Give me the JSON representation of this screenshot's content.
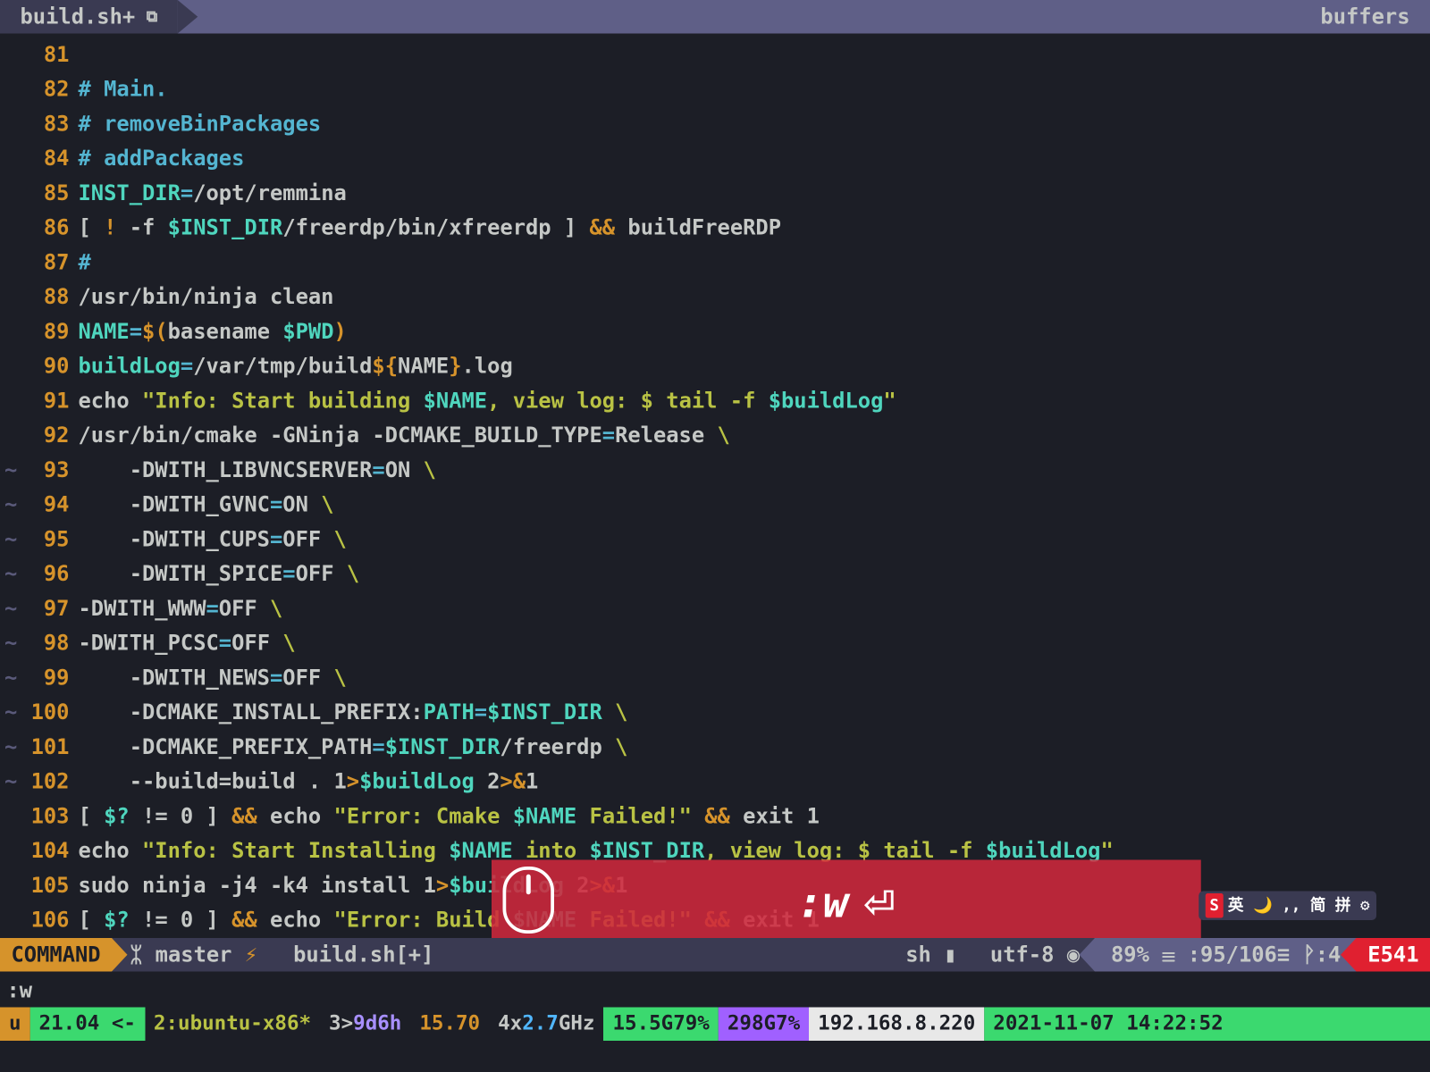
{
  "tab": {
    "name": "build.sh+",
    "right": "buffers"
  },
  "code": [
    {
      "n": 81,
      "tilde": false,
      "tokens": []
    },
    {
      "n": 82,
      "tilde": false,
      "tokens": [
        [
          "c-comment",
          "# Main."
        ]
      ]
    },
    {
      "n": 83,
      "tilde": false,
      "tokens": [
        [
          "c-comment",
          "# removeBinPackages"
        ]
      ]
    },
    {
      "n": 84,
      "tilde": false,
      "tokens": [
        [
          "c-comment",
          "# addPackages"
        ]
      ]
    },
    {
      "n": 85,
      "tilde": false,
      "tokens": [
        [
          "c-var",
          "INST_DIR"
        ],
        [
          "c-eq",
          "="
        ],
        [
          "c-plain",
          "/opt/remmina"
        ]
      ]
    },
    {
      "n": 86,
      "tilde": false,
      "tokens": [
        [
          "c-plain",
          "[ "
        ],
        [
          "c-yellow",
          "!"
        ],
        [
          "c-plain",
          " -f "
        ],
        [
          "c-var",
          "$INST_DIR"
        ],
        [
          "c-plain",
          "/freerdp/bin/xfreerdp ] "
        ],
        [
          "c-yellow",
          "&&"
        ],
        [
          "c-plain",
          " buildFreeRDP"
        ]
      ]
    },
    {
      "n": 87,
      "tilde": false,
      "tokens": [
        [
          "c-comment",
          "#"
        ]
      ]
    },
    {
      "n": 88,
      "tilde": false,
      "tokens": [
        [
          "c-plain",
          "/usr/bin/ninja clean"
        ]
      ]
    },
    {
      "n": 89,
      "tilde": false,
      "tokens": [
        [
          "c-var",
          "NAME"
        ],
        [
          "c-eq",
          "="
        ],
        [
          "c-yellow",
          "$("
        ],
        [
          "c-plain",
          "basename "
        ],
        [
          "c-var",
          "$PWD"
        ],
        [
          "c-yellow",
          ")"
        ]
      ]
    },
    {
      "n": 90,
      "tilde": false,
      "tokens": [
        [
          "c-var",
          "buildLog"
        ],
        [
          "c-eq",
          "="
        ],
        [
          "c-plain",
          "/var/tmp/build"
        ],
        [
          "c-yellow",
          "${"
        ],
        [
          "c-plain",
          "NAME"
        ],
        [
          "c-yellow",
          "}"
        ],
        [
          "c-plain",
          ".log"
        ]
      ]
    },
    {
      "n": 91,
      "tilde": false,
      "tokens": [
        [
          "c-plain",
          "echo "
        ],
        [
          "c-str",
          "\"Info: Start building "
        ],
        [
          "c-strvar",
          "$NAME"
        ],
        [
          "c-str",
          ", view log: $ tail -f "
        ],
        [
          "c-strvar",
          "$buildLog"
        ],
        [
          "c-str",
          "\""
        ]
      ]
    },
    {
      "n": 92,
      "tilde": false,
      "tokens": [
        [
          "c-plain",
          "/usr/bin/cmake -GNinja -DCMAKE_BUILD_TYPE"
        ],
        [
          "c-eq",
          "="
        ],
        [
          "c-plain",
          "Release "
        ],
        [
          "c-escape",
          "\\"
        ]
      ]
    },
    {
      "n": 93,
      "tilde": true,
      "tokens": [
        [
          "c-plain",
          "    -DWITH_LIBVNCSERVER"
        ],
        [
          "c-eq",
          "="
        ],
        [
          "c-plain",
          "ON "
        ],
        [
          "c-escape",
          "\\"
        ]
      ]
    },
    {
      "n": 94,
      "tilde": true,
      "tokens": [
        [
          "c-plain",
          "    -DWITH_GVNC"
        ],
        [
          "c-eq",
          "="
        ],
        [
          "c-plain",
          "ON "
        ],
        [
          "c-escape",
          "\\"
        ]
      ]
    },
    {
      "n": 95,
      "tilde": true,
      "tokens": [
        [
          "c-plain",
          "    -DWITH_CUPS"
        ],
        [
          "c-eq",
          "="
        ],
        [
          "c-plain",
          "OFF "
        ],
        [
          "c-escape",
          "\\"
        ]
      ]
    },
    {
      "n": 96,
      "tilde": true,
      "tokens": [
        [
          "c-plain",
          "    -DWITH_SPICE"
        ],
        [
          "c-eq",
          "="
        ],
        [
          "c-plain",
          "OFF "
        ],
        [
          "c-escape",
          "\\"
        ]
      ]
    },
    {
      "n": 97,
      "tilde": true,
      "tokens": [
        [
          "c-plain",
          "-DWITH_WWW"
        ],
        [
          "c-eq",
          "="
        ],
        [
          "c-plain",
          "OFF "
        ],
        [
          "c-escape",
          "\\"
        ]
      ]
    },
    {
      "n": 98,
      "tilde": true,
      "tokens": [
        [
          "c-plain",
          "-DWITH_PCSC"
        ],
        [
          "c-eq",
          "="
        ],
        [
          "c-plain",
          "OFF "
        ],
        [
          "c-escape",
          "\\"
        ]
      ]
    },
    {
      "n": 99,
      "tilde": true,
      "tokens": [
        [
          "c-plain",
          "    -DWITH_NEWS"
        ],
        [
          "c-eq",
          "="
        ],
        [
          "c-plain",
          "OFF "
        ],
        [
          "c-escape",
          "\\"
        ]
      ]
    },
    {
      "n": 100,
      "tilde": true,
      "tokens": [
        [
          "c-plain",
          "    -DCMAKE_INSTALL_PREFIX:"
        ],
        [
          "c-keyword",
          "PATH"
        ],
        [
          "c-eq",
          "="
        ],
        [
          "c-var",
          "$INST_DIR"
        ],
        [
          "c-plain",
          " "
        ],
        [
          "c-escape",
          "\\"
        ]
      ]
    },
    {
      "n": 101,
      "tilde": true,
      "tokens": [
        [
          "c-plain",
          "    -DCMAKE_PREFIX_PATH"
        ],
        [
          "c-eq",
          "="
        ],
        [
          "c-var",
          "$INST_DIR"
        ],
        [
          "c-plain",
          "/freerdp "
        ],
        [
          "c-escape",
          "\\"
        ]
      ]
    },
    {
      "n": 102,
      "tilde": true,
      "tokens": [
        [
          "c-plain",
          "    --build=build . 1"
        ],
        [
          "c-yellow",
          ">"
        ],
        [
          "c-var",
          "$buildLog"
        ],
        [
          "c-plain",
          " 2"
        ],
        [
          "c-yellow",
          ">&"
        ],
        [
          "c-plain",
          "1"
        ]
      ]
    },
    {
      "n": 103,
      "tilde": false,
      "tokens": [
        [
          "c-plain",
          "[ "
        ],
        [
          "c-var",
          "$?"
        ],
        [
          "c-plain",
          " != 0 ] "
        ],
        [
          "c-yellow",
          "&&"
        ],
        [
          "c-plain",
          " echo "
        ],
        [
          "c-str",
          "\"Error: Cmake "
        ],
        [
          "c-strvar",
          "$NAME"
        ],
        [
          "c-str",
          " Failed!\""
        ],
        [
          "c-plain",
          " "
        ],
        [
          "c-yellow",
          "&&"
        ],
        [
          "c-plain",
          " exit 1"
        ]
      ]
    },
    {
      "n": 104,
      "tilde": false,
      "tokens": [
        [
          "c-plain",
          "echo "
        ],
        [
          "c-str",
          "\"Info: Start Installing "
        ],
        [
          "c-strvar",
          "$NAME"
        ],
        [
          "c-str",
          " into "
        ],
        [
          "c-strvar",
          "$INST_DIR"
        ],
        [
          "c-str",
          ", view log: $ tail -f "
        ],
        [
          "c-strvar",
          "$buildLog"
        ],
        [
          "c-str",
          "\""
        ]
      ]
    },
    {
      "n": 105,
      "tilde": false,
      "tokens": [
        [
          "c-plain",
          "sudo ninja -j4 -k4 install 1"
        ],
        [
          "c-yellow",
          ">"
        ],
        [
          "c-var",
          "$buildLog"
        ],
        [
          "c-plain",
          " 2"
        ],
        [
          "c-yellow",
          ">&"
        ],
        [
          "c-plain",
          "1"
        ]
      ]
    },
    {
      "n": 106,
      "tilde": false,
      "tokens": [
        [
          "c-plain",
          "[ "
        ],
        [
          "c-var",
          "$?"
        ],
        [
          "c-plain",
          " != 0 ] "
        ],
        [
          "c-yellow",
          "&&"
        ],
        [
          "c-plain",
          " echo "
        ],
        [
          "c-str",
          "\"Error: Build "
        ],
        [
          "c-strvar",
          "$NAME"
        ],
        [
          "c-str",
          " Failed!\""
        ],
        [
          "c-plain",
          " "
        ],
        [
          "c-yellow",
          "&&"
        ],
        [
          "c-plain",
          " exit 1"
        ]
      ]
    }
  ],
  "overlay": {
    "text": ":w",
    "return": "⏎"
  },
  "ime": {
    "logo": "S",
    "text": "英 🌙 ,, 简 拼 ⚙"
  },
  "status": {
    "mode": "COMMAND",
    "branch_icon": "ᛯ",
    "branch": "master",
    "bolt": "⚡",
    "file": "build.sh[+]",
    "ft": "sh ▮",
    "enc": "utf-8 ◉",
    "pct": "89% ☰ :95/106≡ ᚹ:4",
    "err": "E541"
  },
  "cmd": ":w",
  "tmux": {
    "u": "u",
    "ver": "21.04 <-",
    "host": "2:ubuntu-x86*",
    "acc_pre": "3>",
    "acc": "9d6h",
    "load": "15.70",
    "cpu_pre": "4x",
    "cpu_hl": "2.7",
    "cpu_suf": "GHz",
    "mem1": "15.5G79%",
    "mem2": "298G7%",
    "ip": "192.168.8.220",
    "date": "2021-11-07 14:22:52"
  }
}
